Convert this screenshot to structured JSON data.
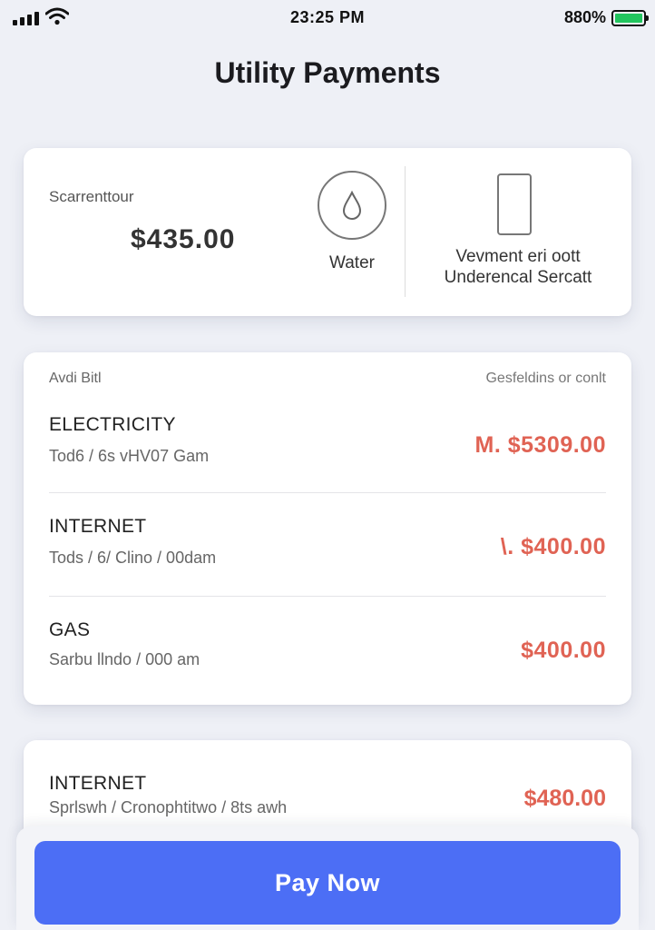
{
  "status_bar": {
    "time": "23:25 PM",
    "battery_percent": "880%",
    "battery_level": 1.0,
    "battery_color": "#22c55e"
  },
  "page": {
    "title": "Utility Payments"
  },
  "summary": {
    "label": "Scarrenttour",
    "amount": "$435.00",
    "water_icon": "water-drop-icon",
    "water_label": "Water",
    "device_icon": "phone-icon",
    "device_label_line1": "Vevment eri oott",
    "device_label_line2": "Underencal Sercatt"
  },
  "bills": {
    "header_left": "Avdi Bitl",
    "header_right": "Gesfeldins or conlt",
    "items": [
      {
        "name": "ELECTRICITY",
        "sub": "Tod6 / 6s vHV07 Gam",
        "amount": "M. $5309.00"
      },
      {
        "name": "INTERNET",
        "sub": "Tods / 6/ Clino / 00dam",
        "amount": "\\. $400.00"
      },
      {
        "name": "GAS",
        "sub": "Sarbu llndo / 000 am",
        "amount": "$400.00"
      }
    ]
  },
  "extra": {
    "name": "INTERNET",
    "sub": "Sprlswh / Cronophtitwo / 8ts awh",
    "amount": "$480.00"
  },
  "pay": {
    "label": "Pay Now"
  },
  "colors": {
    "accent": "#4c6ef5",
    "amount": "#e06354",
    "background": "#eef0f6"
  }
}
